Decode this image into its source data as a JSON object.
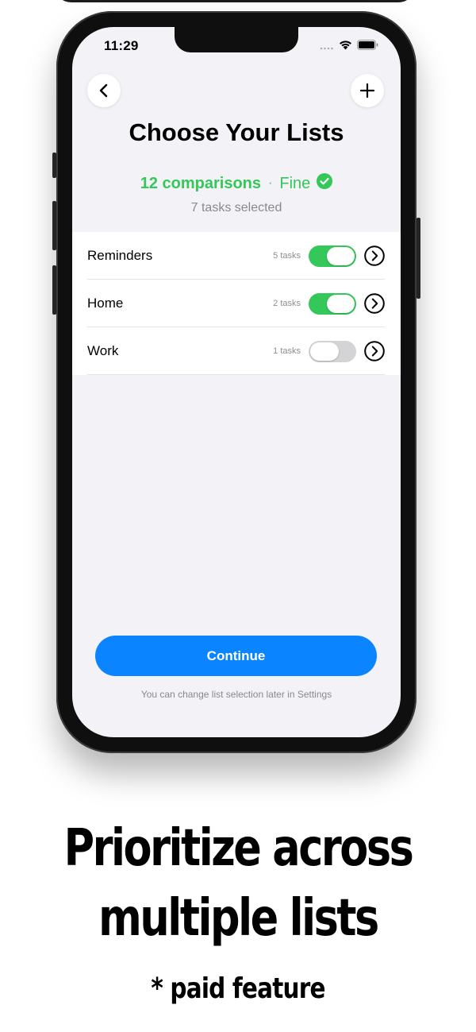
{
  "status_bar": {
    "time": "11:29",
    "icons": [
      "cellular-icon",
      "wifi-icon",
      "battery-icon"
    ]
  },
  "nav": {
    "back_icon": "chevron-left-icon",
    "add_icon": "plus-icon"
  },
  "title": "Choose Your Lists",
  "summary": {
    "comparisons": "12 comparisons",
    "separator": "·",
    "rating": "Fine",
    "rating_icon": "checkmark-circle-icon"
  },
  "tasks_selected": "7 tasks selected",
  "lists": [
    {
      "name": "Reminders",
      "count": "5 tasks",
      "enabled": true
    },
    {
      "name": "Home",
      "count": "2 tasks",
      "enabled": true
    },
    {
      "name": "Work",
      "count": "1 tasks",
      "enabled": false
    }
  ],
  "continue_label": "Continue",
  "footnote": "You can change list selection later in Settings",
  "promo": {
    "headline_line1": "Prioritize across",
    "headline_line2": "multiple lists",
    "subhead": "* paid feature"
  },
  "colors": {
    "accent_green": "#34c759",
    "button_blue": "#0a84ff",
    "background": "#f2f2f7"
  }
}
